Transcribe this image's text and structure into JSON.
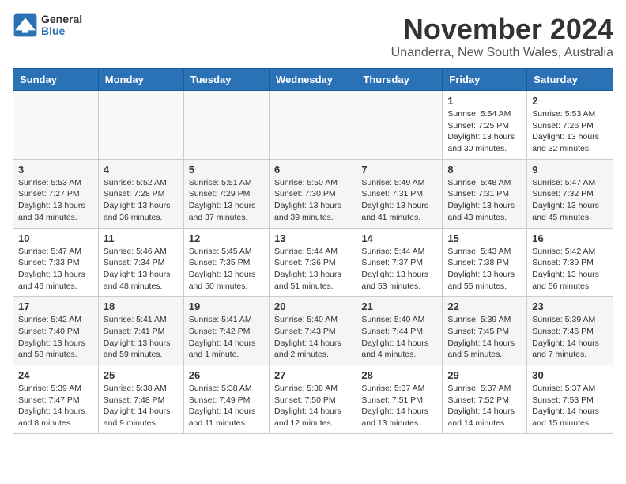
{
  "header": {
    "logo_general": "General",
    "logo_blue": "Blue",
    "month_title": "November 2024",
    "location": "Unanderra, New South Wales, Australia"
  },
  "days_of_week": [
    "Sunday",
    "Monday",
    "Tuesday",
    "Wednesday",
    "Thursday",
    "Friday",
    "Saturday"
  ],
  "weeks": [
    [
      {
        "day": "",
        "info": ""
      },
      {
        "day": "",
        "info": ""
      },
      {
        "day": "",
        "info": ""
      },
      {
        "day": "",
        "info": ""
      },
      {
        "day": "",
        "info": ""
      },
      {
        "day": "1",
        "info": "Sunrise: 5:54 AM\nSunset: 7:25 PM\nDaylight: 13 hours and 30 minutes."
      },
      {
        "day": "2",
        "info": "Sunrise: 5:53 AM\nSunset: 7:26 PM\nDaylight: 13 hours and 32 minutes."
      }
    ],
    [
      {
        "day": "3",
        "info": "Sunrise: 5:53 AM\nSunset: 7:27 PM\nDaylight: 13 hours and 34 minutes."
      },
      {
        "day": "4",
        "info": "Sunrise: 5:52 AM\nSunset: 7:28 PM\nDaylight: 13 hours and 36 minutes."
      },
      {
        "day": "5",
        "info": "Sunrise: 5:51 AM\nSunset: 7:29 PM\nDaylight: 13 hours and 37 minutes."
      },
      {
        "day": "6",
        "info": "Sunrise: 5:50 AM\nSunset: 7:30 PM\nDaylight: 13 hours and 39 minutes."
      },
      {
        "day": "7",
        "info": "Sunrise: 5:49 AM\nSunset: 7:31 PM\nDaylight: 13 hours and 41 minutes."
      },
      {
        "day": "8",
        "info": "Sunrise: 5:48 AM\nSunset: 7:31 PM\nDaylight: 13 hours and 43 minutes."
      },
      {
        "day": "9",
        "info": "Sunrise: 5:47 AM\nSunset: 7:32 PM\nDaylight: 13 hours and 45 minutes."
      }
    ],
    [
      {
        "day": "10",
        "info": "Sunrise: 5:47 AM\nSunset: 7:33 PM\nDaylight: 13 hours and 46 minutes."
      },
      {
        "day": "11",
        "info": "Sunrise: 5:46 AM\nSunset: 7:34 PM\nDaylight: 13 hours and 48 minutes."
      },
      {
        "day": "12",
        "info": "Sunrise: 5:45 AM\nSunset: 7:35 PM\nDaylight: 13 hours and 50 minutes."
      },
      {
        "day": "13",
        "info": "Sunrise: 5:44 AM\nSunset: 7:36 PM\nDaylight: 13 hours and 51 minutes."
      },
      {
        "day": "14",
        "info": "Sunrise: 5:44 AM\nSunset: 7:37 PM\nDaylight: 13 hours and 53 minutes."
      },
      {
        "day": "15",
        "info": "Sunrise: 5:43 AM\nSunset: 7:38 PM\nDaylight: 13 hours and 55 minutes."
      },
      {
        "day": "16",
        "info": "Sunrise: 5:42 AM\nSunset: 7:39 PM\nDaylight: 13 hours and 56 minutes."
      }
    ],
    [
      {
        "day": "17",
        "info": "Sunrise: 5:42 AM\nSunset: 7:40 PM\nDaylight: 13 hours and 58 minutes."
      },
      {
        "day": "18",
        "info": "Sunrise: 5:41 AM\nSunset: 7:41 PM\nDaylight: 13 hours and 59 minutes."
      },
      {
        "day": "19",
        "info": "Sunrise: 5:41 AM\nSunset: 7:42 PM\nDaylight: 14 hours and 1 minute."
      },
      {
        "day": "20",
        "info": "Sunrise: 5:40 AM\nSunset: 7:43 PM\nDaylight: 14 hours and 2 minutes."
      },
      {
        "day": "21",
        "info": "Sunrise: 5:40 AM\nSunset: 7:44 PM\nDaylight: 14 hours and 4 minutes."
      },
      {
        "day": "22",
        "info": "Sunrise: 5:39 AM\nSunset: 7:45 PM\nDaylight: 14 hours and 5 minutes."
      },
      {
        "day": "23",
        "info": "Sunrise: 5:39 AM\nSunset: 7:46 PM\nDaylight: 14 hours and 7 minutes."
      }
    ],
    [
      {
        "day": "24",
        "info": "Sunrise: 5:39 AM\nSunset: 7:47 PM\nDaylight: 14 hours and 8 minutes."
      },
      {
        "day": "25",
        "info": "Sunrise: 5:38 AM\nSunset: 7:48 PM\nDaylight: 14 hours and 9 minutes."
      },
      {
        "day": "26",
        "info": "Sunrise: 5:38 AM\nSunset: 7:49 PM\nDaylight: 14 hours and 11 minutes."
      },
      {
        "day": "27",
        "info": "Sunrise: 5:38 AM\nSunset: 7:50 PM\nDaylight: 14 hours and 12 minutes."
      },
      {
        "day": "28",
        "info": "Sunrise: 5:37 AM\nSunset: 7:51 PM\nDaylight: 14 hours and 13 minutes."
      },
      {
        "day": "29",
        "info": "Sunrise: 5:37 AM\nSunset: 7:52 PM\nDaylight: 14 hours and 14 minutes."
      },
      {
        "day": "30",
        "info": "Sunrise: 5:37 AM\nSunset: 7:53 PM\nDaylight: 14 hours and 15 minutes."
      }
    ]
  ]
}
